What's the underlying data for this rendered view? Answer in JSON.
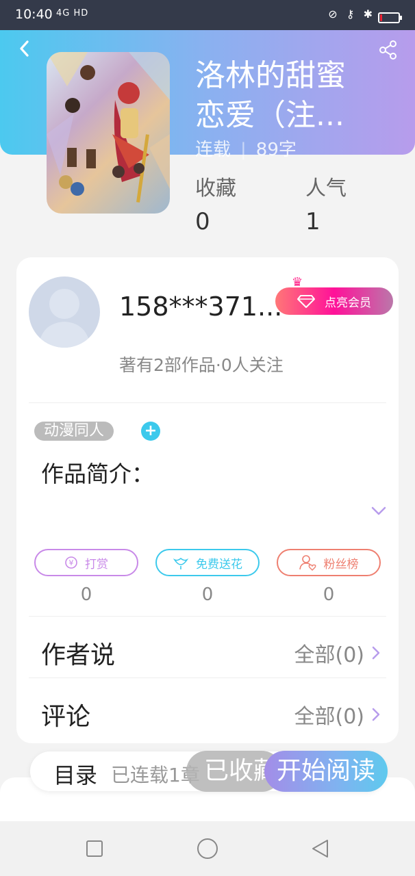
{
  "status_bar": {
    "time": "10:40",
    "network": "4G HD",
    "battery_level": 0.12
  },
  "book": {
    "title_line1": "洛林的甜蜜",
    "title_line2": "恋爱（注...",
    "status": "连载",
    "word_count": "89字"
  },
  "stats": {
    "favorites_label": "收藏",
    "favorites_value": "0",
    "popularity_label": "人气",
    "popularity_value": "1"
  },
  "author": {
    "name": "158***371...",
    "vip_label": "点亮会员",
    "summary": "著有2部作品·0人关注"
  },
  "tag": {
    "label": "动漫同人",
    "add": "+"
  },
  "intro": {
    "label": "作品简介："
  },
  "actions": [
    {
      "label": "打赏",
      "count": "0",
      "color": "#c889e8"
    },
    {
      "label": "免费送花",
      "count": "0",
      "color": "#3cc9ec"
    },
    {
      "label": "粉丝榜",
      "count": "0",
      "color": "#ee7f70"
    }
  ],
  "rows": {
    "author_says": {
      "title": "作者说",
      "right": "全部(0)"
    },
    "comments": {
      "title": "评论",
      "right": "全部(0)"
    }
  },
  "bottom": {
    "toc_label": "目录",
    "toc_status": "已连载1章",
    "favorited_label": "已收藏",
    "read_label": "开始阅读"
  }
}
